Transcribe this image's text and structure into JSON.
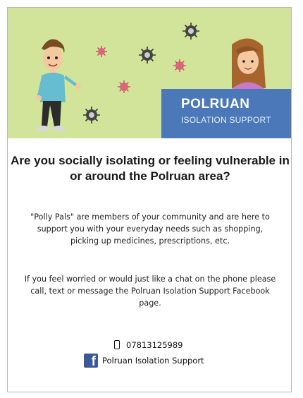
{
  "banner": {
    "title": "POLRUAN",
    "subtitle": "ISOLATION SUPPORT",
    "colors": {
      "background": "#d2e49a",
      "brand_box": "#4a78b8"
    },
    "icons": [
      "man-illustration",
      "woman-illustration",
      "virus-icon"
    ]
  },
  "headline": "Are you socially isolating or feeling vulnerable in or around the Polruan area?",
  "paragraphs": [
    "\"Polly Pals\"  are members of your community and are here to support you with your everyday needs such as shopping, picking up medicines, prescriptions, etc.",
    "If you feel worried or would just like a chat on the phone please call, text or message the Polruan Isolation Support Facebook page."
  ],
  "contact": {
    "phone_icon": "mobile-phone-icon",
    "phone": "07813125989",
    "facebook_icon": "facebook-icon",
    "facebook_page": "Polruan Isolation Support"
  }
}
